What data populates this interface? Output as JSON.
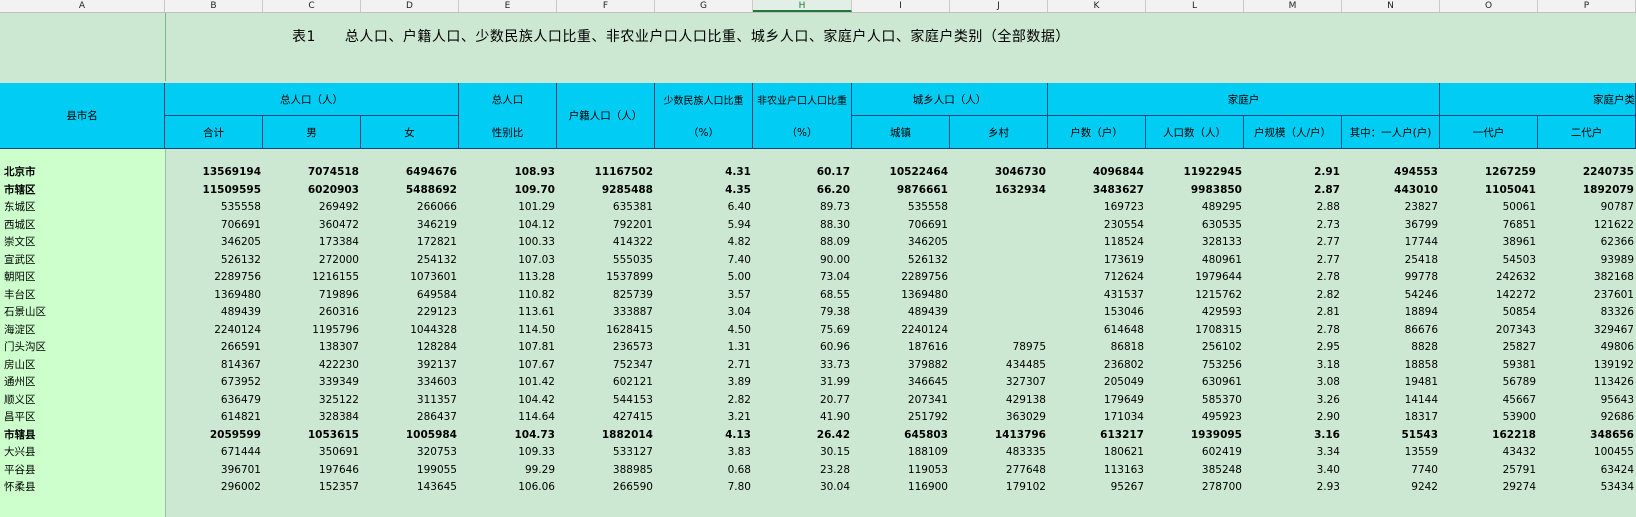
{
  "column_letters": [
    "A",
    "B",
    "C",
    "D",
    "E",
    "F",
    "G",
    "H",
    "I",
    "J",
    "K",
    "L",
    "M",
    "N",
    "O",
    "P"
  ],
  "selected_column": "H",
  "title": "表1　　总人口、户籍人口、少数民族人口比重、非农业户口人口比重、城乡人口、家庭户人口、家庭户类别（全部数据）",
  "header": {
    "county_name": "县市名",
    "total_pop": "总人口（人）",
    "total": "合计",
    "male": "男",
    "female": "女",
    "sex_ratio_1": "总人口",
    "sex_ratio_2": "性别比",
    "huji": "户籍人口（人）",
    "minority_1": "少数民族人口比重",
    "minority_2": "（%）",
    "nonagri_1": "非农业户口人口比重",
    "nonagri_2": "（%）",
    "urban_rural": "城乡人口（人）",
    "urban": "城镇",
    "rural": "乡村",
    "family": "家庭户",
    "hh_count": "户数（户）",
    "hh_pop": "人口数（人）",
    "hh_size": "户规模（人/户）",
    "one_person": "其中：一人户(户)",
    "hh_type": "家庭户类",
    "gen1": "一代户",
    "gen2": "二代户"
  },
  "rows": [
    {
      "name": "北京市",
      "bold": true,
      "v": [
        "13569194",
        "7074518",
        "6494676",
        "108.93",
        "11167502",
        "4.31",
        "60.17",
        "10522464",
        "3046730",
        "4096844",
        "11922945",
        "2.91",
        "494553",
        "1267259",
        "2240735"
      ]
    },
    {
      "name": "市辖区",
      "bold": true,
      "v": [
        "11509595",
        "6020903",
        "5488692",
        "109.70",
        "9285488",
        "4.35",
        "66.20",
        "9876661",
        "1632934",
        "3483627",
        "9983850",
        "2.87",
        "443010",
        "1105041",
        "1892079"
      ]
    },
    {
      "name": "东城区",
      "bold": false,
      "v": [
        "535558",
        "269492",
        "266066",
        "101.29",
        "635381",
        "6.40",
        "89.73",
        "535558",
        "",
        "169723",
        "489295",
        "2.88",
        "23827",
        "50061",
        "90787"
      ]
    },
    {
      "name": "西城区",
      "bold": false,
      "v": [
        "706691",
        "360472",
        "346219",
        "104.12",
        "792201",
        "5.94",
        "88.30",
        "706691",
        "",
        "230554",
        "630535",
        "2.73",
        "36799",
        "76851",
        "121622"
      ]
    },
    {
      "name": "崇文区",
      "bold": false,
      "v": [
        "346205",
        "173384",
        "172821",
        "100.33",
        "414322",
        "4.82",
        "88.09",
        "346205",
        "",
        "118524",
        "328133",
        "2.77",
        "17744",
        "38961",
        "62366"
      ]
    },
    {
      "name": "宣武区",
      "bold": false,
      "v": [
        "526132",
        "272000",
        "254132",
        "107.03",
        "555035",
        "7.40",
        "90.00",
        "526132",
        "",
        "173619",
        "480961",
        "2.77",
        "25418",
        "54503",
        "93989"
      ]
    },
    {
      "name": "朝阳区",
      "bold": false,
      "v": [
        "2289756",
        "1216155",
        "1073601",
        "113.28",
        "1537899",
        "5.00",
        "73.04",
        "2289756",
        "",
        "712624",
        "1979644",
        "2.78",
        "99778",
        "242632",
        "382168"
      ]
    },
    {
      "name": "丰台区",
      "bold": false,
      "v": [
        "1369480",
        "719896",
        "649584",
        "110.82",
        "825739",
        "3.57",
        "68.55",
        "1369480",
        "",
        "431537",
        "1215762",
        "2.82",
        "54246",
        "142272",
        "237601"
      ]
    },
    {
      "name": "石景山区",
      "bold": false,
      "v": [
        "489439",
        "260316",
        "229123",
        "113.61",
        "333887",
        "3.04",
        "79.38",
        "489439",
        "",
        "153046",
        "429593",
        "2.81",
        "18894",
        "50854",
        "83326"
      ]
    },
    {
      "name": "海淀区",
      "bold": false,
      "v": [
        "2240124",
        "1195796",
        "1044328",
        "114.50",
        "1628415",
        "4.50",
        "75.69",
        "2240124",
        "",
        "614648",
        "1708315",
        "2.78",
        "86676",
        "207343",
        "329467"
      ]
    },
    {
      "name": "门头沟区",
      "bold": false,
      "v": [
        "266591",
        "138307",
        "128284",
        "107.81",
        "236573",
        "1.31",
        "60.96",
        "187616",
        "78975",
        "86818",
        "256102",
        "2.95",
        "8828",
        "25827",
        "49806"
      ]
    },
    {
      "name": "房山区",
      "bold": false,
      "v": [
        "814367",
        "422230",
        "392137",
        "107.67",
        "752347",
        "2.71",
        "33.73",
        "379882",
        "434485",
        "236802",
        "753256",
        "3.18",
        "18858",
        "59381",
        "139192"
      ]
    },
    {
      "name": "通州区",
      "bold": false,
      "v": [
        "673952",
        "339349",
        "334603",
        "101.42",
        "602121",
        "3.89",
        "31.99",
        "346645",
        "327307",
        "205049",
        "630961",
        "3.08",
        "19481",
        "56789",
        "113426"
      ]
    },
    {
      "name": "顺义区",
      "bold": false,
      "v": [
        "636479",
        "325122",
        "311357",
        "104.42",
        "544153",
        "2.82",
        "20.77",
        "207341",
        "429138",
        "179649",
        "585370",
        "3.26",
        "14144",
        "45667",
        "95643"
      ]
    },
    {
      "name": "昌平区",
      "bold": false,
      "v": [
        "614821",
        "328384",
        "286437",
        "114.64",
        "427415",
        "3.21",
        "41.90",
        "251792",
        "363029",
        "171034",
        "495923",
        "2.90",
        "18317",
        "53900",
        "92686"
      ]
    },
    {
      "name": "市辖县",
      "bold": true,
      "v": [
        "2059599",
        "1053615",
        "1005984",
        "104.73",
        "1882014",
        "4.13",
        "26.42",
        "645803",
        "1413796",
        "613217",
        "1939095",
        "3.16",
        "51543",
        "162218",
        "348656"
      ]
    },
    {
      "name": "大兴县",
      "bold": false,
      "v": [
        "671444",
        "350691",
        "320753",
        "109.33",
        "533127",
        "3.83",
        "30.15",
        "188109",
        "483335",
        "180621",
        "602419",
        "3.34",
        "13559",
        "43432",
        "100455"
      ]
    },
    {
      "name": "平谷县",
      "bold": false,
      "v": [
        "396701",
        "197646",
        "199055",
        "99.29",
        "388985",
        "0.68",
        "23.28",
        "119053",
        "277648",
        "113163",
        "385248",
        "3.40",
        "7740",
        "25791",
        "63424"
      ]
    },
    {
      "name": "怀柔县",
      "bold": false,
      "v": [
        "296002",
        "152357",
        "143645",
        "106.06",
        "266590",
        "7.80",
        "30.04",
        "116900",
        "179102",
        "95267",
        "278700",
        "2.93",
        "9242",
        "29274",
        "53434"
      ]
    }
  ]
}
